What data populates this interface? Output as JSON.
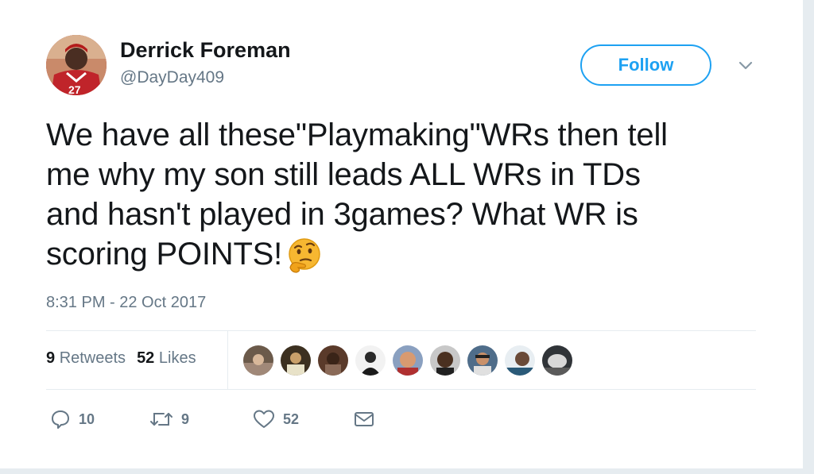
{
  "author": {
    "name": "Derrick Foreman",
    "handle": "@DayDay409"
  },
  "header": {
    "follow_label": "Follow",
    "menu_icon": "chevron-down-icon"
  },
  "tweet": {
    "lines": [
      "We have all these\"Playmaking\"WRs then tell",
      "me why my son still leads ALL WRs in TDs",
      "and hasn't played in 3games? What WR is",
      "scoring POINTS!"
    ],
    "emoji": "thinking-face-emoji",
    "timestamp": "8:31 PM - 22 Oct 2017"
  },
  "stats": {
    "retweets_count": "9",
    "retweets_label": "Retweets",
    "likes_count": "52",
    "likes_label": "Likes",
    "liker_avatar_count": 9
  },
  "actions": {
    "reply_count": "10",
    "retweet_count": "9",
    "like_count": "52",
    "reply_icon": "reply-icon",
    "retweet_icon": "retweet-icon",
    "like_icon": "heart-icon",
    "message_icon": "envelope-icon"
  },
  "colors": {
    "accent": "#1da1f2",
    "muted_text": "#657786",
    "text": "#14171a",
    "divider": "#e6ecf0"
  }
}
